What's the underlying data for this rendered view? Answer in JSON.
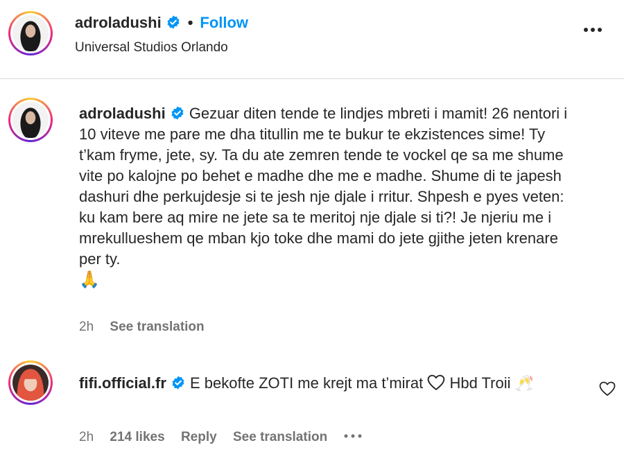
{
  "post_header": {
    "username": "adroladushi",
    "separator": "•",
    "follow_label": "Follow",
    "location": "Universal Studios Orlando"
  },
  "caption": {
    "username": "adroladushi",
    "text": "Gezuar diten tende te lindjes mbreti i mamit! 26 nentori i 10 viteve me pare me dha titullin me te bukur te ekzistences sime! Ty t’kam fryme, jete, sy. Ta du ate zemren tende te vockel qe sa me shume vite po kalojne po behet e madhe dhe me e madhe. Shume di te japesh dashuri dhe perkujdesje si te jesh nje djale i rritur. Shpesh e pyes veten: ku kam bere aq mire ne jete sa te meritoj nje djale si ti?! Je njeriu me i mrekullueshem qe mban kjo toke dhe mami do jete gjithe jeten krenare per ty.",
    "emoji": "🙏",
    "time": "2h",
    "see_translation": "See translation"
  },
  "comment": {
    "username": "fifi.official.fr",
    "text_before": "E bekofte ZOTI me krejt ma t’mirat",
    "text_after": "Hbd Troii",
    "emoji": "🥂",
    "time": "2h",
    "likes": "214 likes",
    "reply": "Reply",
    "see_translation": "See translation"
  },
  "colors": {
    "accent": "#0095f6",
    "verified": "#0095f6",
    "text": "#262626",
    "secondary_text": "#737373",
    "divider": "#dbdbdb"
  },
  "icons": {
    "verified": "verified-badge-icon",
    "more": "more-options-icon",
    "heart": "heart-icon",
    "like": "like-heart-icon",
    "ellipsis": "ellipsis-icon"
  }
}
